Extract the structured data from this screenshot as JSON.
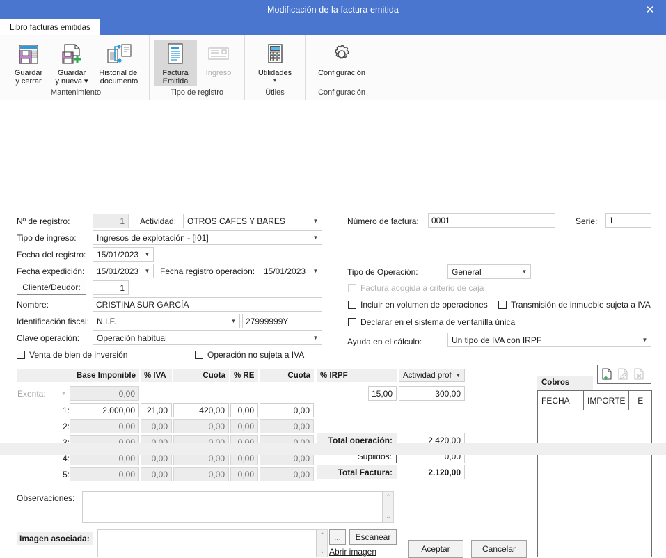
{
  "window": {
    "title": "Modificación de la factura emitida",
    "close_icon": "close-icon"
  },
  "ribbon": {
    "tab": "Libro facturas emitidas",
    "groups": [
      {
        "label": "Mantenimiento",
        "buttons": [
          {
            "label_line1": "Guardar",
            "label_line2": "y cerrar",
            "icon": "save-close-icon",
            "state": "enabled"
          },
          {
            "label_line1": "Guardar",
            "label_line2": "y nueva",
            "icon": "save-new-icon",
            "state": "enabled",
            "caret": "▾"
          },
          {
            "label_line1": "Historial del",
            "label_line2": "documento",
            "icon": "document-history-icon",
            "state": "enabled"
          }
        ]
      },
      {
        "label": "Tipo de registro",
        "buttons": [
          {
            "label_line1": "Factura",
            "label_line2": "Emitida",
            "icon": "invoice-icon",
            "state": "selected"
          },
          {
            "label_line1": "Ingreso",
            "label_line2": "",
            "icon": "income-icon",
            "state": "disabled"
          }
        ]
      },
      {
        "label": "Útiles",
        "buttons": [
          {
            "label_line1": "Utilidades",
            "label_line2": "",
            "icon": "calculator-icon",
            "state": "enabled",
            "caret": "▾"
          }
        ]
      },
      {
        "label": "Configuración",
        "buttons": [
          {
            "label_line1": "Configuración",
            "label_line2": "",
            "icon": "gear-icon",
            "state": "enabled"
          }
        ]
      }
    ]
  },
  "form": {
    "num_registro_label": "Nº de registro:",
    "num_registro_value": "1",
    "actividad_label": "Actividad:",
    "actividad_value": "OTROS CAFES Y BARES",
    "tipo_ingreso_label": "Tipo de ingreso:",
    "tipo_ingreso_value": "Ingresos de explotación - [I01]",
    "fecha_registro_label": "Fecha del registro:",
    "fecha_registro_value": "15/01/2023",
    "fecha_expedicion_label": "Fecha expedición:",
    "fecha_expedicion_value": "15/01/2023",
    "fecha_operacion_label": "Fecha registro operación:",
    "fecha_operacion_value": "15/01/2023",
    "cliente_button": "Cliente/Deudor:",
    "cliente_value": "1",
    "nombre_label": "Nombre:",
    "nombre_value": "CRISTINA SUR GARCÍA",
    "identificacion_label": "Identificación fiscal:",
    "identificacion_type": "N.I.F.",
    "identificacion_value": "27999999Y",
    "clave_operacion_label": "Clave operación:",
    "clave_operacion_value": "Operación habitual",
    "chk_venta_bien": "Venta de bien de inversión",
    "chk_no_sujeta": "Operación no sujeta a IVA",
    "numero_factura_label": "Número de factura:",
    "numero_factura_value": "0001",
    "serie_label": "Serie:",
    "serie_value": "1",
    "tipo_operacion_label": "Tipo de Operación:",
    "tipo_operacion_value": "General",
    "chk_criterio_caja": "Factura acogida a criterio de caja",
    "chk_incluir_volumen": "Incluir en  volumen de operaciones",
    "chk_transmision": "Transmisión de inmueble sujeta a IVA",
    "chk_ventanilla": "Declarar en el sistema de ventanilla única",
    "ayuda_calculo_label": "Ayuda en el cálculo:",
    "ayuda_calculo_value": "Un tipo de IVA con IRPF"
  },
  "grid": {
    "headers": {
      "base": "Base Imponible",
      "iva": "% IVA",
      "cuota1": "Cuota",
      "re": "% RE",
      "cuota2": "Cuota",
      "irpf": "% IRPF",
      "actividad": "Actividad prof"
    },
    "exenta_label": "Exenta:",
    "exenta_value": "0,00",
    "irpf_pct": "15,00",
    "irpf_importe": "300,00",
    "rows": [
      {
        "num": "1:",
        "base": "2.000,00",
        "iva": "21,00",
        "cuota1": "420,00",
        "re": "0,00",
        "cuota2": "0,00",
        "enabled": true
      },
      {
        "num": "2:",
        "base": "0,00",
        "iva": "0,00",
        "cuota1": "0,00",
        "re": "0,00",
        "cuota2": "0,00",
        "enabled": false
      },
      {
        "num": "3:",
        "base": "0,00",
        "iva": "0,00",
        "cuota1": "0,00",
        "re": "0,00",
        "cuota2": "0,00",
        "enabled": false
      },
      {
        "num": "4:",
        "base": "0,00",
        "iva": "0,00",
        "cuota1": "0,00",
        "re": "0,00",
        "cuota2": "0,00",
        "enabled": false
      },
      {
        "num": "5:",
        "base": "0,00",
        "iva": "0,00",
        "cuota1": "0,00",
        "re": "0,00",
        "cuota2": "0,00",
        "enabled": false
      }
    ],
    "totals": {
      "total_operacion_label": "Total operación:",
      "total_operacion_value": "2.420,00",
      "suplidos_label": "Suplidos:",
      "suplidos_value": "0,00",
      "total_factura_label": "Total Factura:",
      "total_factura_value": "2.120,00"
    }
  },
  "cobros": {
    "title": "Cobros",
    "tools": [
      {
        "icon": "new-document-icon",
        "state": "enabled"
      },
      {
        "icon": "edit-document-icon",
        "state": "disabled"
      },
      {
        "icon": "delete-document-icon",
        "state": "disabled"
      }
    ],
    "columns": [
      "FECHA",
      "IMPORTE",
      "E"
    ],
    "rows": []
  },
  "bottom": {
    "observaciones_label": "Observaciones:",
    "observaciones_value": "",
    "imagen_label": "Imagen asociada:",
    "imagen_value": "",
    "browse_button": "...",
    "scan_button": "Escanear",
    "open_image_link": "Abrir imagen",
    "accept_button": "Aceptar",
    "cancel_button": "Cancelar"
  },
  "colors": {
    "titlebar": "#4a76cf",
    "selected_item": "#d8d8d8",
    "field_disabled": "#ececec",
    "header_shade": "#efefef"
  }
}
